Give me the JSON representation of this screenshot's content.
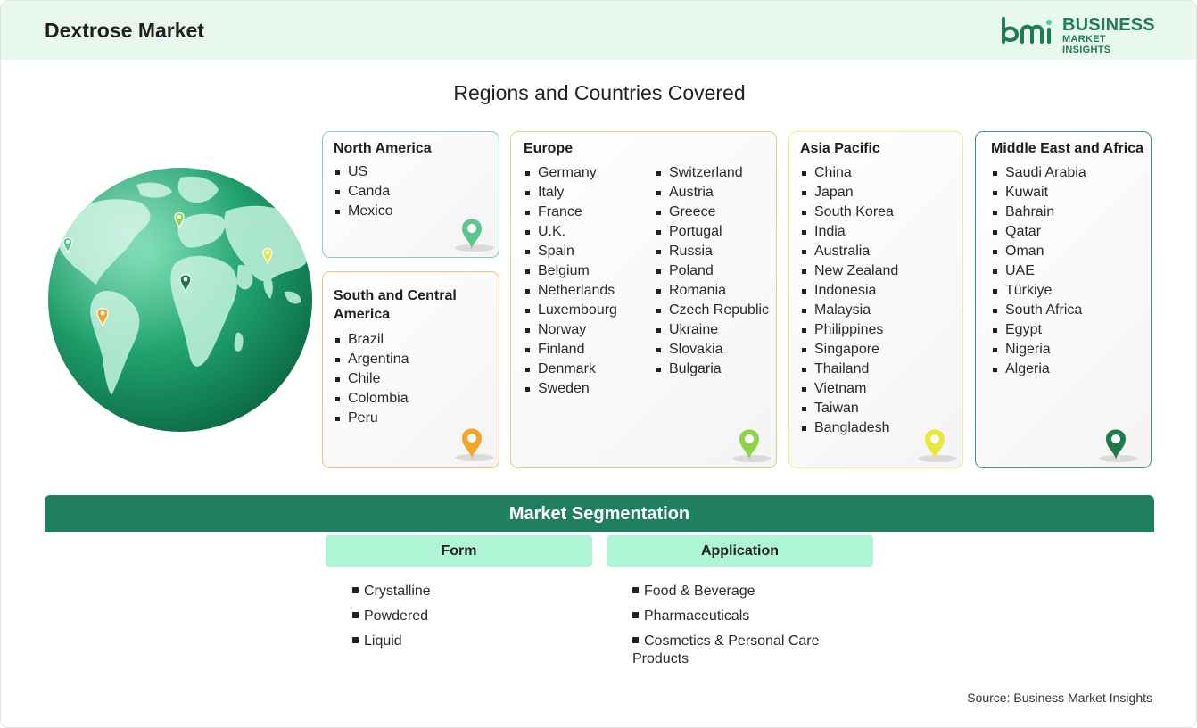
{
  "header": {
    "title": "Dextrose Market"
  },
  "logo": {
    "mark": "bmi",
    "line1": "BUSINESS",
    "line2": "MARKET INSIGHTS",
    "color": "#1e7a57"
  },
  "section_title": "Regions and Countries Covered",
  "regions": [
    {
      "name": "North America",
      "color": "#5ac88c",
      "countries": [
        "US",
        "Canda",
        "Mexico"
      ]
    },
    {
      "name": "South and Central America",
      "color": "#f4a42a",
      "countries": [
        "Brazil",
        "Argentina",
        "Chile",
        "Colombia",
        "Peru"
      ]
    },
    {
      "name": "Europe",
      "color": "#8fd44b",
      "countries_col1": [
        "Germany",
        "Italy",
        "France",
        "U.K.",
        "Spain",
        "Belgium",
        "Netherlands",
        "Luxembourg",
        "Norway",
        "Finland",
        "Denmark",
        "Sweden"
      ],
      "countries_col2": [
        "Switzerland",
        "Austria",
        "Greece",
        "Portugal",
        "Russia",
        "Poland",
        "Romania",
        "Czech Republic",
        "Ukraine",
        "Slovakia",
        "Bulgaria"
      ]
    },
    {
      "name": "Asia Pacific",
      "color": "#e8e83a",
      "countries": [
        "China",
        "Japan",
        "South Korea",
        "India",
        "Australia",
        "New Zealand",
        "Indonesia",
        "Malaysia",
        "Philippines",
        "Singapore",
        "Thailand",
        "Vietnam",
        "Taiwan",
        "Bangladesh"
      ]
    },
    {
      "name": "Middle East and Africa",
      "color": "#1e7a4a",
      "countries": [
        "Saudi Arabia",
        "Kuwait",
        "Bahrain",
        "Qatar",
        "Oman",
        "UAE",
        "Türkiye",
        "South Africa",
        "Egypt",
        "Nigeria",
        "Algeria"
      ]
    }
  ],
  "segmentation": {
    "title": "Market Segmentation",
    "columns": [
      {
        "header": "Form",
        "items": [
          "Crystalline",
          "Powdered",
          "Liquid"
        ]
      },
      {
        "header": "Application",
        "items": [
          "Food & Beverage",
          "Pharmaceuticals",
          "Cosmetics & Personal Care Products"
        ]
      }
    ]
  },
  "source": "Source: Business Market Insights",
  "icons": [
    "globe-icon",
    "map-pin-icon"
  ]
}
